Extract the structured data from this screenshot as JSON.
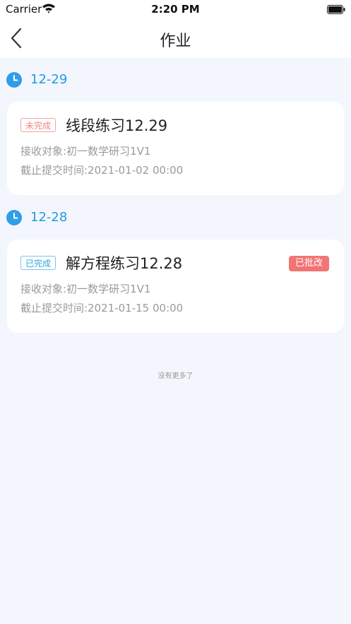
{
  "statusbar": {
    "carrier": "Carrier",
    "time": "2:20 PM"
  },
  "navbar": {
    "title": "作业"
  },
  "groups": [
    {
      "date": "12-29",
      "card": {
        "status_tag": "未完成",
        "title": "线段练习12.29",
        "receiver": "接收对象:初一数学研习1V1",
        "deadline": "截止提交时间:2021-01-02 00:00"
      }
    },
    {
      "date": "12-28",
      "card": {
        "status_tag": "已完成",
        "title": "解方程练习12.28",
        "badge": "已批改",
        "receiver": "接收对象:初一数学研习1V1",
        "deadline": "截止提交时间:2021-01-15 00:00"
      }
    }
  ],
  "footer": {
    "text": "没有更多了"
  },
  "colors": {
    "accent": "#1e9be6",
    "incomplete": "#f08585",
    "graded": "#f27474",
    "background": "#f3f7fd"
  }
}
